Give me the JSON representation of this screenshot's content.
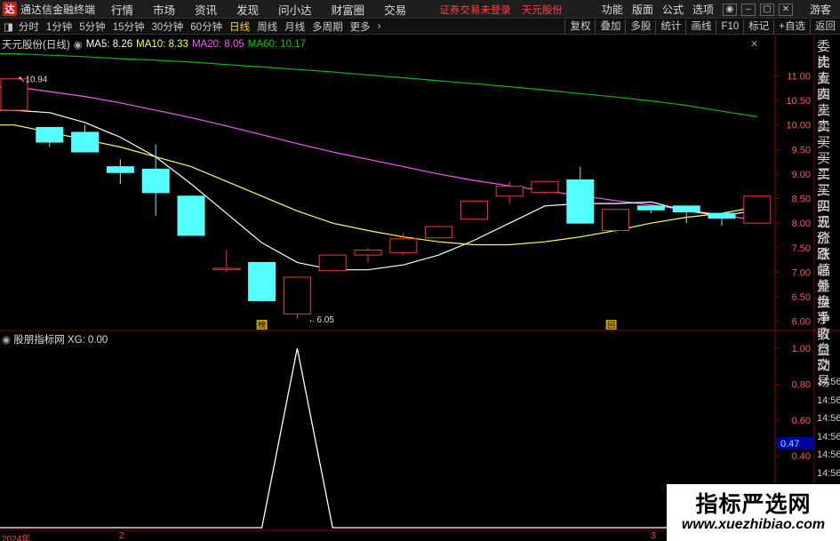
{
  "menubar": {
    "logo_text": "达",
    "app_name": "通达信金融终端",
    "items": [
      "行情",
      "市场",
      "资讯",
      "发现",
      "问小达",
      "财富圈",
      "交易"
    ],
    "status_warning": "证券交易未登录",
    "stock_name": "天元股份",
    "right_items": [
      "功能",
      "版面",
      "公式",
      "选项"
    ],
    "guest_label": "游客"
  },
  "periodbar": {
    "tabs": [
      "分时",
      "1分钟",
      "5分钟",
      "15分钟",
      "30分钟",
      "60分钟",
      "日线",
      "周线",
      "月线",
      "多周期",
      "更多"
    ],
    "active": "日线",
    "tools": [
      "复权",
      "叠加",
      "多股",
      "统计",
      "画线",
      "F10",
      "标记",
      "+自选",
      "返回"
    ]
  },
  "main_chart": {
    "title": "天元股份(日线)",
    "ma5_label": "MA5: 8.26",
    "ma10_label": "MA10: 8.33",
    "ma20_label": "MA20: 8.05",
    "ma60_label": "MA60: 10.17",
    "high_marker": "10.94",
    "low_marker": "6.05",
    "marker_bang": "榜",
    "marker_hui": "回",
    "y_ticks": [
      "11.00",
      "10.50",
      "10.00",
      "9.50",
      "9.00",
      "8.50",
      "8.00",
      "7.50",
      "7.00",
      "6.50",
      "6.00"
    ],
    "colors": {
      "up": "#ff3232",
      "down": "#54ffff",
      "ma5": "#ffffff",
      "ma10": "#ffff54",
      "ma20": "#ff54ff",
      "ma60": "#00c000"
    }
  },
  "sub_chart": {
    "title": "股朋指标网 XG: 0.00",
    "y_ticks": [
      "1.00",
      "0.80",
      "0.60",
      "0.40",
      "0.20"
    ],
    "cursor_value": "0.47"
  },
  "sidebar_quote": {
    "labels": [
      "委比",
      "卖五",
      "卖四",
      "卖三",
      "卖二",
      "卖一",
      "买一",
      "买二",
      "买三",
      "买四",
      "买五",
      "现价",
      "涨跌",
      "涨幅",
      "总量",
      "外盘",
      "换手",
      "净资",
      "收益"
    ],
    "lower_labels": [
      "自动",
      "交易"
    ],
    "times": [
      "14:56",
      "14:56",
      "14:56",
      "14:56",
      "14:56",
      "14:56",
      "14:56",
      "14:56"
    ]
  },
  "bottom_axis": {
    "labels": [
      "2024年",
      "2",
      "3"
    ]
  },
  "watermark": {
    "title": "指标严选网",
    "url": "www.xuezhibiao.com"
  },
  "chart_data": {
    "type": "candlestick",
    "title": "天元股份(日线)",
    "candles": [
      {
        "o": 10.3,
        "c": 10.94,
        "h": 10.94,
        "l": 10.3
      },
      {
        "o": 9.95,
        "c": 9.65,
        "h": 9.95,
        "l": 9.55
      },
      {
        "o": 9.85,
        "c": 9.45,
        "h": 10.0,
        "l": 9.45
      },
      {
        "o": 9.15,
        "c": 9.03,
        "h": 9.3,
        "l": 8.8
      },
      {
        "o": 9.1,
        "c": 8.62,
        "h": 9.6,
        "l": 8.15
      },
      {
        "o": 8.55,
        "c": 7.75,
        "h": 8.55,
        "l": 7.75
      },
      {
        "o": 7.05,
        "c": 7.08,
        "h": 7.45,
        "l": 7.0
      },
      {
        "o": 7.2,
        "c": 6.42,
        "h": 7.2,
        "l": 6.4
      },
      {
        "o": 6.15,
        "c": 6.9,
        "h": 6.9,
        "l": 6.05
      },
      {
        "o": 7.03,
        "c": 7.35,
        "h": 7.35,
        "l": 7.03
      },
      {
        "o": 7.35,
        "c": 7.45,
        "h": 7.5,
        "l": 7.2
      },
      {
        "o": 7.4,
        "c": 7.68,
        "h": 7.8,
        "l": 7.35
      },
      {
        "o": 7.7,
        "c": 7.93,
        "h": 7.95,
        "l": 7.7
      },
      {
        "o": 8.08,
        "c": 8.45,
        "h": 8.45,
        "l": 8.08
      },
      {
        "o": 8.55,
        "c": 8.75,
        "h": 8.85,
        "l": 8.4
      },
      {
        "o": 8.63,
        "c": 8.85,
        "h": 8.85,
        "l": 8.6
      },
      {
        "o": 8.88,
        "c": 8.0,
        "h": 9.15,
        "l": 8.0
      },
      {
        "o": 7.85,
        "c": 8.28,
        "h": 8.28,
        "l": 7.8
      },
      {
        "o": 8.35,
        "c": 8.27,
        "h": 8.35,
        "l": 8.2
      },
      {
        "o": 8.35,
        "c": 8.23,
        "h": 8.35,
        "l": 8.0
      },
      {
        "o": 8.2,
        "c": 8.1,
        "h": 8.2,
        "l": 7.95
      },
      {
        "o": 8.0,
        "c": 8.55,
        "h": 8.55,
        "l": 8.0
      }
    ],
    "ma5": [
      10.3,
      10.25,
      10.05,
      9.75,
      9.35,
      8.8,
      8.2,
      7.6,
      7.2,
      7.05,
      7.05,
      7.15,
      7.35,
      7.65,
      8.0,
      8.35,
      8.4,
      8.4,
      8.43,
      8.25,
      8.15,
      8.26
    ],
    "ma10": [
      10.0,
      9.85,
      9.7,
      9.55,
      9.35,
      9.15,
      8.85,
      8.55,
      8.25,
      8.0,
      7.85,
      7.72,
      7.62,
      7.56,
      7.56,
      7.62,
      7.72,
      7.85,
      8.0,
      8.12,
      8.2,
      8.33
    ],
    "ma20": [
      10.78,
      10.68,
      10.58,
      10.45,
      10.3,
      10.15,
      9.98,
      9.8,
      9.62,
      9.45,
      9.3,
      9.15,
      9.0,
      8.87,
      8.76,
      8.66,
      8.56,
      8.46,
      8.37,
      8.27,
      8.17,
      8.05
    ],
    "ma60": [
      11.45,
      11.42,
      11.39,
      11.35,
      11.32,
      11.28,
      11.23,
      11.18,
      11.13,
      11.08,
      11.02,
      10.96,
      10.9,
      10.84,
      10.78,
      10.71,
      10.64,
      10.57,
      10.49,
      10.4,
      10.28,
      10.17
    ],
    "xg": [
      0,
      0,
      0,
      0,
      0,
      0,
      0,
      0,
      1,
      0,
      0,
      0,
      0,
      0,
      0,
      0,
      0,
      0,
      0,
      0,
      0,
      0
    ],
    "ylim": [
      5.85,
      11.55
    ],
    "sub_ylim": [
      0,
      1.0
    ]
  }
}
